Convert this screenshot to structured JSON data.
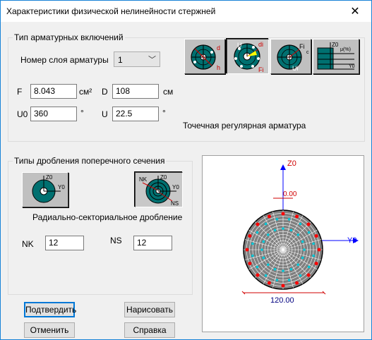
{
  "window": {
    "title": "Характеристики физической нелинейности стержней",
    "close_glyph": "✕"
  },
  "reinforcement": {
    "group_label": "Тип арматурных включений",
    "layer_label": "Номер слоя арматуры",
    "layer_value": "1",
    "F_label": "F",
    "F_value": "8.043",
    "F_unit": "см²",
    "D_label": "D",
    "D_value": "108",
    "D_unit": "см",
    "U0_label": "U0",
    "U0_value": "360",
    "U0_unit": "°",
    "U_label": "U",
    "U_value": "22.5",
    "U_unit": "°",
    "type_text": "Точечная регулярная арматура",
    "type_buttons": [
      {
        "name": "point-reinforcement",
        "labels": [
          "d",
          "h"
        ]
      },
      {
        "name": "regular-point-reinforcement",
        "labels": [
          "U",
          "di",
          "Fi"
        ]
      },
      {
        "name": "fi-reinforcement",
        "labels": [
          "Fi",
          "c",
          "Ui"
        ]
      },
      {
        "name": "percent-reinforcement",
        "labels": [
          "Z0",
          "μ(%)",
          "Y0"
        ]
      }
    ]
  },
  "division": {
    "group_label": "Типы дробления поперечного сечения",
    "mode_text": "Радиально-секториальное дробление",
    "NK_label": "NK",
    "NK_value": "12",
    "NS_label": "NS",
    "NS_value": "12",
    "buttons": [
      {
        "name": "simple-division",
        "labels": [
          "Z0",
          "Y0"
        ]
      },
      {
        "name": "radial-sector-division",
        "labels": [
          "NK",
          "Z0",
          "Y0",
          "NS"
        ]
      }
    ]
  },
  "preview": {
    "z_axis": "Z0",
    "y_axis": "Y0",
    "offset_label": "0.00",
    "diameter_label": "120.00"
  },
  "buttons": {
    "confirm": "Подтвердить",
    "draw": "Нарисовать",
    "cancel": "Отменить",
    "help": "Справка"
  },
  "colors": {
    "accent": "#0078d7",
    "section_fill": "#808080",
    "rebar": "#ff0000",
    "fiber_point": "#00c8d8",
    "axis": "#0000ff",
    "dimension": "#c00000"
  }
}
